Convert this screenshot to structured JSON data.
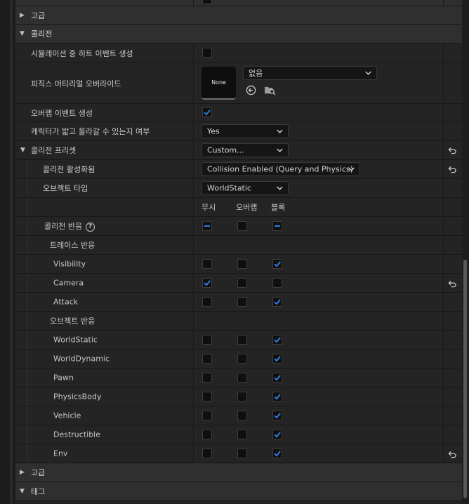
{
  "sections": {
    "advanced_top": "고급",
    "collision": "콜리전",
    "advanced_bottom": "고급",
    "tags": "태그"
  },
  "collision": {
    "sim_hit_events": {
      "label": "시뮬레이션 중 히트 이벤트 생성",
      "checked": false
    },
    "phys_override": {
      "label": "피직스 머티리얼 오버라이드",
      "thumb": "None",
      "value": "없음"
    },
    "overlap_events": {
      "label": "오버랩 이벤트 생성",
      "checked": true
    },
    "step_up": {
      "label": "캐릭터가 밟고 올라갈 수 있는지 여부",
      "value": "Yes"
    },
    "preset": {
      "label": "콜리전 프리셋",
      "value": "Custom..."
    },
    "enabled": {
      "label": "콜리전 활성화됨",
      "value": "Collision Enabled (Query and Physics)"
    },
    "object_type": {
      "label": "오브젝트 타입",
      "value": "WorldStatic"
    },
    "columns": [
      "무시",
      "오버랩",
      "블록"
    ],
    "responses_label": "콜리전 반응",
    "help_glyph": "?",
    "trace_label": "트레이스 반응",
    "object_label": "오브젝트 반응",
    "trace_rows": [
      {
        "name": "Visibility",
        "state": "block",
        "reset": false
      },
      {
        "name": "Camera",
        "state": "ignore",
        "reset": true
      },
      {
        "name": "Attack",
        "state": "block",
        "reset": false
      }
    ],
    "object_rows": [
      {
        "name": "WorldStatic",
        "state": "block",
        "reset": false
      },
      {
        "name": "WorldDynamic",
        "state": "block",
        "reset": false
      },
      {
        "name": "Pawn",
        "state": "block",
        "reset": false
      },
      {
        "name": "PhysicsBody",
        "state": "block",
        "reset": false
      },
      {
        "name": "Vehicle",
        "state": "block",
        "reset": false
      },
      {
        "name": "Destructible",
        "state": "block",
        "reset": false
      },
      {
        "name": "Env",
        "state": "block",
        "reset": true
      }
    ]
  },
  "icons": {
    "expand": "triangle-right-icon",
    "collapse": "triangle-down-icon",
    "reset": "reset-arrow-icon",
    "browse": "browse-asset-icon",
    "find": "find-in-content-icon"
  },
  "colors": {
    "accent": "#2e7be0",
    "panel": "#242424",
    "section": "#2f2f2f"
  }
}
